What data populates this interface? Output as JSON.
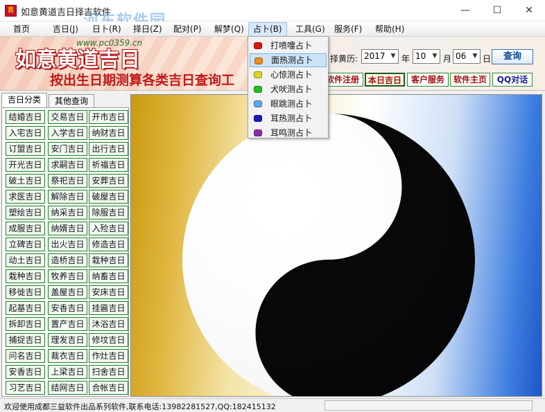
{
  "window": {
    "title": "如意黄道吉日择吉软件",
    "overlay_watermark": "河东软件园"
  },
  "menu": [
    {
      "label": "首页"
    },
    {
      "label": "吉日(J)"
    },
    {
      "label": "日卜(R)"
    },
    {
      "label": "择日(Z)"
    },
    {
      "label": "配对(P)"
    },
    {
      "label": "解梦(Q)"
    },
    {
      "label": "占卜(B)"
    },
    {
      "label": "工具(G)"
    },
    {
      "label": "服务(F)"
    },
    {
      "label": "帮助(H)"
    }
  ],
  "banner": {
    "logo": "如意黄道吉日",
    "url": "www.pc0359.cn",
    "slogan": "按出生日期测算各类吉日查询工",
    "date_label": "择黄历:",
    "year_value": "2017",
    "year_unit": "年",
    "month_value": "10",
    "month_unit": "月",
    "day_value": "06",
    "day_unit": "日",
    "query_button": "查询",
    "buttons": [
      "软件注册",
      "本日吉日",
      "客户服务",
      "软件主页",
      "QQ对话"
    ]
  },
  "left_tabs": [
    "吉日分类",
    "其他查询"
  ],
  "categories": [
    "结婚吉日",
    "交易吉日",
    "开市吉日",
    "入宅吉日",
    "入学吉日",
    "纳财吉日",
    "订盟吉日",
    "安门吉日",
    "出行吉日",
    "开光吉日",
    "求嗣吉日",
    "祈福吉日",
    "破土吉日",
    "祭祀吉日",
    "安葬吉日",
    "求医吉日",
    "解除吉日",
    "破屋吉日",
    "塑绘吉日",
    "纳采吉日",
    "除服吉日",
    "成服吉日",
    "纳婿吉日",
    "入殓吉日",
    "立碑吉日",
    "出火吉日",
    "修造吉日",
    "动土吉日",
    "造桥吉日",
    "栽种吉日",
    "栽种吉日",
    "牧养吉日",
    "纳畜吉日",
    "移徙吉日",
    "盖屋吉日",
    "安床吉日",
    "起基吉日",
    "安香吉日",
    "挂匾吉日",
    "拆卸吉日",
    "置产吉日",
    "沐浴吉日",
    "捕捉吉日",
    "理发吉日",
    "修坟吉日",
    "问名吉日",
    "裁衣吉日",
    "作灶吉日",
    "安香吉日",
    "上梁吉日",
    "扫舍吉日",
    "习艺吉日",
    "结网吉日",
    "合帐吉日"
  ],
  "dropdown": {
    "items": [
      {
        "label": "打喷嚏占卜",
        "color": "#d81818"
      },
      {
        "label": "面热测占卜",
        "color": "#f08c1a"
      },
      {
        "label": "心惊测占卜",
        "color": "#d8d820"
      },
      {
        "label": "犬吠测占卜",
        "color": "#20c020"
      },
      {
        "label": "眼跳测占卜",
        "color": "#60a8e8"
      },
      {
        "label": "耳热测占卜",
        "color": "#1818c0"
      },
      {
        "label": "耳鸣测占卜",
        "color": "#8a2ab0"
      }
    ],
    "highlighted_index": 1
  },
  "status": {
    "text": "欢迎使用成都三益软件出品系列软件,联系电话:13982281527,QQ:182415132"
  }
}
